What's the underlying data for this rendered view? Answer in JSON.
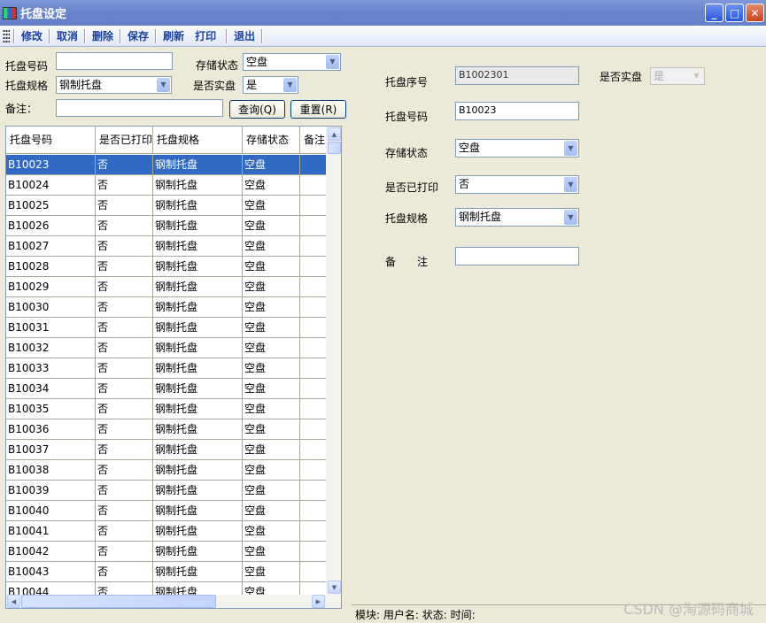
{
  "window": {
    "title": "托盘设定"
  },
  "toolbar": {
    "items": [
      "修改",
      "取消",
      "删除",
      "保存",
      "刷新",
      "打印",
      "退出"
    ]
  },
  "search": {
    "pallet_no_label": "托盘号码",
    "pallet_no_value": "",
    "storage_status_label": "存储状态",
    "storage_status_value": "空盘",
    "spec_label": "托盘规格",
    "spec_value": "钢制托盘",
    "is_full_label": "是否实盘",
    "is_full_value": "是",
    "remark_label": "备注：",
    "remark_value": "",
    "query_button": "查询(Q)",
    "reset_button": "重置(R)"
  },
  "grid": {
    "columns": [
      "托盘号码",
      "是否已打印",
      "托盘规格",
      "存储状态",
      "备注"
    ],
    "rows": [
      [
        "B10023",
        "否",
        "钢制托盘",
        "空盘",
        ""
      ],
      [
        "B10024",
        "否",
        "钢制托盘",
        "空盘",
        ""
      ],
      [
        "B10025",
        "否",
        "钢制托盘",
        "空盘",
        ""
      ],
      [
        "B10026",
        "否",
        "钢制托盘",
        "空盘",
        ""
      ],
      [
        "B10027",
        "否",
        "钢制托盘",
        "空盘",
        ""
      ],
      [
        "B10028",
        "否",
        "钢制托盘",
        "空盘",
        ""
      ],
      [
        "B10029",
        "否",
        "钢制托盘",
        "空盘",
        ""
      ],
      [
        "B10030",
        "否",
        "钢制托盘",
        "空盘",
        ""
      ],
      [
        "B10031",
        "否",
        "钢制托盘",
        "空盘",
        ""
      ],
      [
        "B10032",
        "否",
        "钢制托盘",
        "空盘",
        ""
      ],
      [
        "B10033",
        "否",
        "钢制托盘",
        "空盘",
        ""
      ],
      [
        "B10034",
        "否",
        "钢制托盘",
        "空盘",
        ""
      ],
      [
        "B10035",
        "否",
        "钢制托盘",
        "空盘",
        ""
      ],
      [
        "B10036",
        "否",
        "钢制托盘",
        "空盘",
        ""
      ],
      [
        "B10037",
        "否",
        "钢制托盘",
        "空盘",
        ""
      ],
      [
        "B10038",
        "否",
        "钢制托盘",
        "空盘",
        ""
      ],
      [
        "B10039",
        "否",
        "钢制托盘",
        "空盘",
        ""
      ],
      [
        "B10040",
        "否",
        "钢制托盘",
        "空盘",
        ""
      ],
      [
        "B10041",
        "否",
        "钢制托盘",
        "空盘",
        ""
      ],
      [
        "B10042",
        "否",
        "钢制托盘",
        "空盘",
        ""
      ],
      [
        "B10043",
        "否",
        "钢制托盘",
        "空盘",
        ""
      ],
      [
        "B10044",
        "否",
        "钢制托盘",
        "空盘",
        ""
      ]
    ],
    "selected_row": 0
  },
  "detail": {
    "serial_label": "托盘序号",
    "serial_value": "B1002301",
    "is_full_label": "是否实盘",
    "is_full_value": "是",
    "pallet_no_label": "托盘号码",
    "pallet_no_value": "B10023",
    "storage_status_label": "存储状态",
    "storage_status_value": "空盘",
    "printed_label": "是否已打印",
    "printed_value": "否",
    "spec_label": "托盘规格",
    "spec_value": "钢制托盘",
    "remark_label": "备　　注",
    "remark_value": ""
  },
  "statusbar": {
    "text": "模块: 用户名: 状态: 时间:"
  },
  "watermark": "CSDN @淘源码商城"
}
